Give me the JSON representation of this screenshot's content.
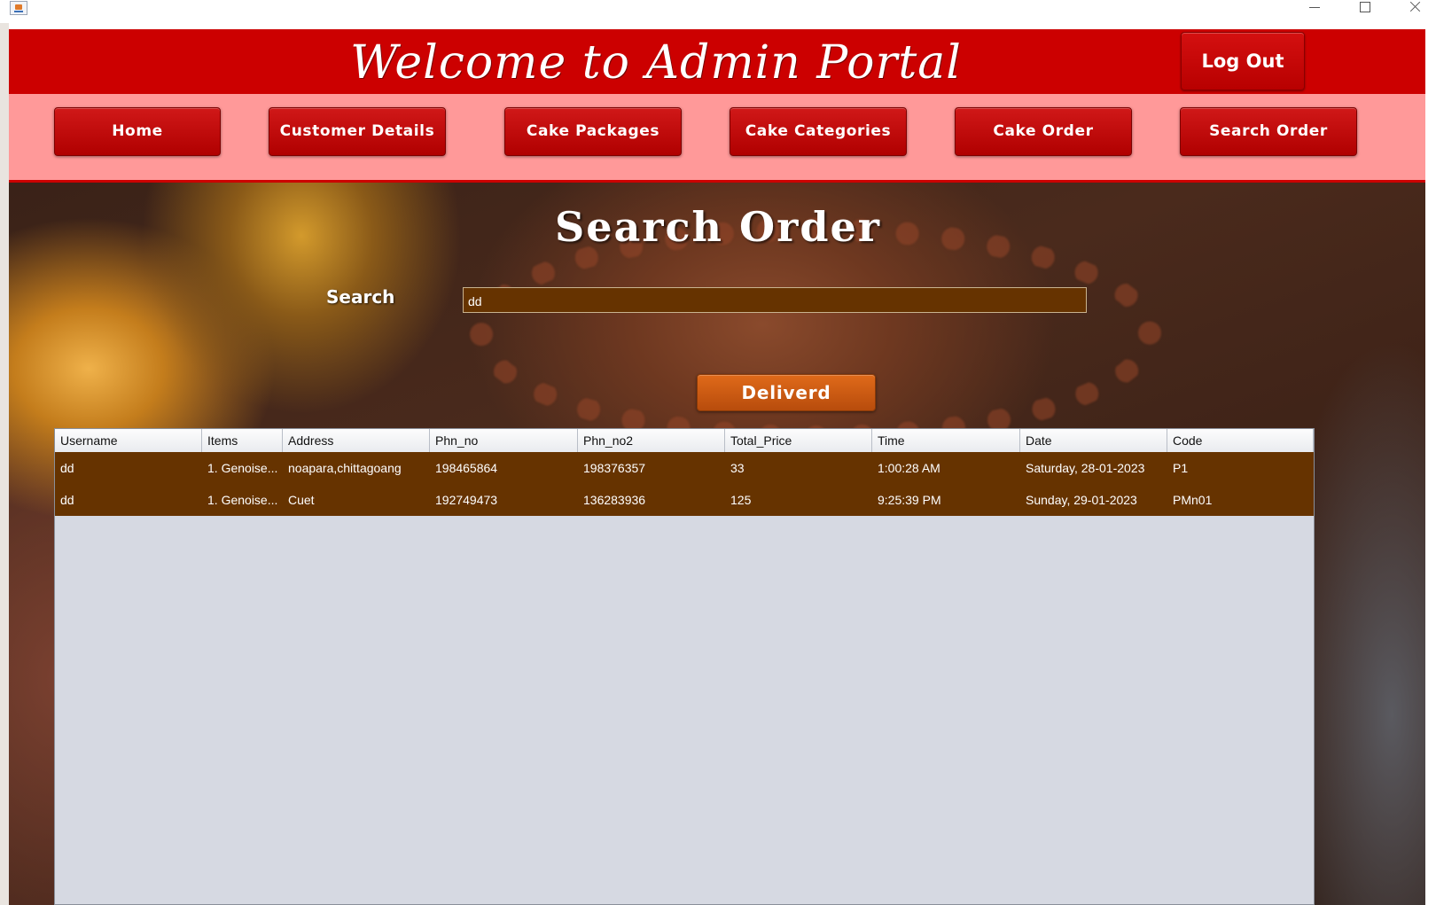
{
  "window": {
    "controls": {
      "minimize": "minimize-icon",
      "maximize": "maximize-icon",
      "close": "close-icon"
    }
  },
  "header": {
    "title": "Welcome to  Admin Portal",
    "logout_label": "Log Out",
    "background_color": "#cc0000"
  },
  "nav": {
    "background_color": "#ff9999",
    "items": [
      {
        "label": "Home"
      },
      {
        "label": "Customer Details"
      },
      {
        "label": "Cake Packages"
      },
      {
        "label": "Cake Categories"
      },
      {
        "label": "Cake Order"
      },
      {
        "label": "Search Order"
      }
    ]
  },
  "main": {
    "heading": "Search Order",
    "search_label": "Search",
    "search_value": "dd",
    "delivered_label": "Deliverd"
  },
  "table": {
    "columns": [
      "Username",
      "Items",
      "Address",
      "Phn_no",
      "Phn_no2",
      "Total_Price",
      "Time",
      "Date",
      "Code"
    ],
    "rows": [
      [
        "dd",
        "1. Genoise...",
        "noapara,chittagoang",
        "198465864",
        "198376357",
        "33",
        "1:00:28 AM",
        "Saturday, 28-01-2023",
        "P1"
      ],
      [
        "dd",
        "1. Genoise...",
        "Cuet",
        "192749473",
        "136283936",
        "125",
        "9:25:39 PM",
        "Sunday, 29-01-2023",
        "PMn01"
      ]
    ],
    "row_color": "#663300"
  }
}
